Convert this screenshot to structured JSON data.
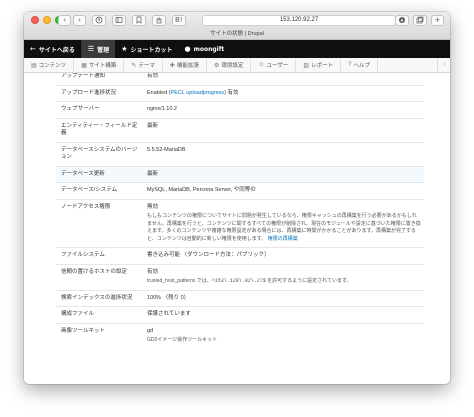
{
  "browser": {
    "url": "153.120.92.27",
    "page_title": "サイトの状態 | Drupal",
    "back_glyph": "‹",
    "forward_glyph": "›",
    "reader_label": "B!"
  },
  "toolbar": {
    "back_to_site": "サイトへ戻る",
    "manage": "管理",
    "shortcuts": "ショートカット",
    "user": "moongift"
  },
  "tray": {
    "items": [
      {
        "label": "コンテンツ",
        "icon": "content-icon"
      },
      {
        "label": "サイト構築",
        "icon": "structure-icon"
      },
      {
        "label": "テーマ",
        "icon": "appearance-icon"
      },
      {
        "label": "機能拡張",
        "icon": "extend-icon"
      },
      {
        "label": "環境設定",
        "icon": "config-icon"
      },
      {
        "label": "ユーザー",
        "icon": "people-icon"
      },
      {
        "label": "レポート",
        "icon": "reports-icon"
      },
      {
        "label": "ヘルプ",
        "icon": "help-icon"
      }
    ]
  },
  "status_rows": [
    {
      "label": "アップデート通知",
      "value": "有効"
    },
    {
      "label": "アップロード進捗状況",
      "value_prefix": "Enabled (",
      "value_link": "PECL uploadprogress",
      "value_suffix": ") 有効"
    },
    {
      "label": "ウェブサーバー",
      "value": "nginx/1.10.2"
    },
    {
      "label": "エンティティー・フィールド定義",
      "value": "最新"
    },
    {
      "label": "データベースシステムのバージョン",
      "value": "5.5.52-MariaDB"
    },
    {
      "label": "データベース更新",
      "value": "最新"
    },
    {
      "label": "データベース/システム",
      "value": "MySQL, MariaDB, Percona Server, や同等の"
    },
    {
      "label": "ノードアクセス権限",
      "value": "無効",
      "desc": "もしもコンテンツの権限についてサイトに問題が発生しているなら、権限キャッシュの再構築を行う必要があるかもしれません。再構築を行うと、コンテンツに関するすべての権限が削除され、現在のモジュールや設定に基づいた権限に置き換えます。多くのコンテンツや複雑な権限設定がある場合には、再構築に時間がかかることがあります。再構築が完了すると、コンテンツは自動的に新しい権限を使用します。",
      "desc_link": "権限の再構築"
    },
    {
      "label": "ファイルシステム",
      "value": "書き込み可能 （ダウンロード方法：パブリック）"
    },
    {
      "label": "信頼の置けるホストの設定",
      "value": "有効",
      "desc_prefix": "trusted_host_patterns では、",
      "desc_code": "^153\\.120\\.92\\.27$",
      "desc_suffix": " を許可するように設定されています。"
    },
    {
      "label": "検索インデックスの進捗状況",
      "value": "100% （残り 0）"
    },
    {
      "label": "構成ファイル",
      "value": "保護されています"
    },
    {
      "label": "画像ツールキット",
      "value": "gd",
      "desc": "GD2イメージ操作ツールキット"
    }
  ],
  "colors": {
    "link": "#0074bd",
    "toolbar": "#0f0f0f",
    "highlight": "#f3f9fd"
  }
}
